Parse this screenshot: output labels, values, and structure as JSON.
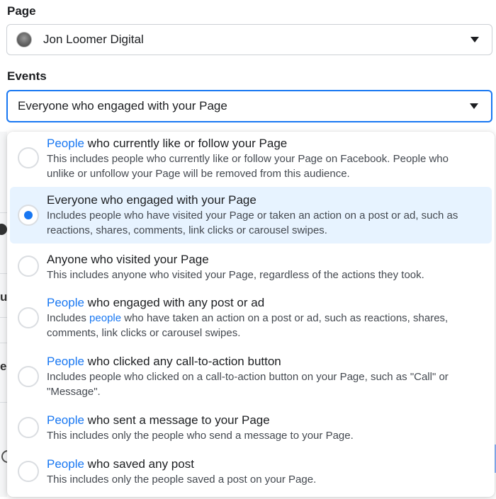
{
  "page_field": {
    "label": "Page",
    "value": "Jon Loomer Digital"
  },
  "events_field": {
    "label": "Events",
    "value": "Everyone who engaged with your Page"
  },
  "background": {
    "glyph_u": "u",
    "glyph_e": "e"
  },
  "options": [
    {
      "link": "People",
      "title": " who currently like or follow your Page",
      "desc": "This includes people who currently like or follow your Page on Facebook. People who unlike or unfollow your Page will be removed from this audience.",
      "selected": false
    },
    {
      "link": "",
      "title": "Everyone who engaged with your Page",
      "desc": "Includes people who have visited your Page or taken an action on a post or ad, such as reactions, shares, comments, link clicks or carousel swipes.",
      "selected": true
    },
    {
      "link": "",
      "title": "Anyone who visited your Page",
      "desc": "This includes anyone who visited your Page, regardless of the actions they took.",
      "selected": false
    },
    {
      "link": "People",
      "title": " who engaged with any post or ad",
      "desc_pre": "Includes ",
      "desc_link": "people",
      "desc_post": " who have taken an action on a post or ad, such as reactions, shares, comments, link clicks or carousel swipes.",
      "selected": false
    },
    {
      "link": "People",
      "title": " who clicked any call-to-action button",
      "desc": "Includes people who clicked on a call-to-action button on your Page, such as \"Call\" or \"Message\".",
      "selected": false
    },
    {
      "link": "People",
      "title": " who sent a message to your Page",
      "desc": "This includes only the people who send a message to your Page.",
      "selected": false
    },
    {
      "link": "People",
      "title": " who saved any post",
      "desc": "This includes only the people saved a post on your Page.",
      "selected": false
    }
  ],
  "colors": {
    "accent": "#1877f2",
    "selected_bg": "#e7f3ff"
  }
}
